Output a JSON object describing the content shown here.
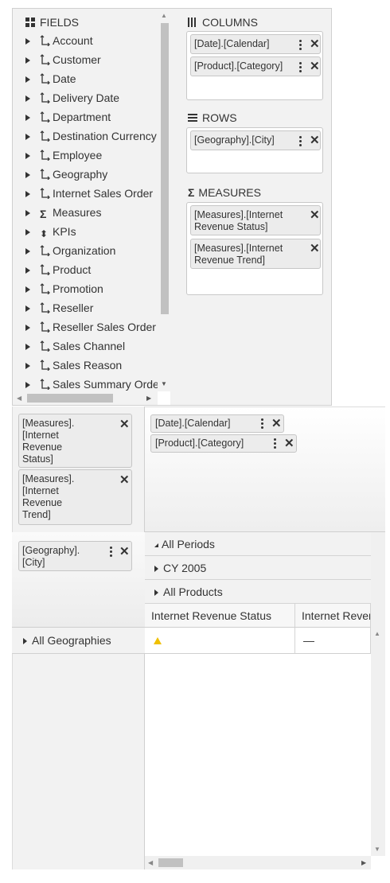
{
  "configurator": {
    "fields_title": "FIELDS",
    "fields": [
      {
        "label": "Account",
        "icon": "hierarchy-icon"
      },
      {
        "label": "Customer",
        "icon": "hierarchy-icon"
      },
      {
        "label": "Date",
        "icon": "hierarchy-icon"
      },
      {
        "label": "Delivery Date",
        "icon": "hierarchy-icon"
      },
      {
        "label": "Department",
        "icon": "hierarchy-icon"
      },
      {
        "label": "Destination Currency",
        "icon": "hierarchy-icon"
      },
      {
        "label": "Employee",
        "icon": "hierarchy-icon"
      },
      {
        "label": "Geography",
        "icon": "hierarchy-icon"
      },
      {
        "label": "Internet Sales Order",
        "icon": "hierarchy-icon"
      },
      {
        "label": "Measures",
        "icon": "sigma-icon"
      },
      {
        "label": "KPIs",
        "icon": "kpi-icon"
      },
      {
        "label": "Organization",
        "icon": "hierarchy-icon"
      },
      {
        "label": "Product",
        "icon": "hierarchy-icon"
      },
      {
        "label": "Promotion",
        "icon": "hierarchy-icon"
      },
      {
        "label": "Reseller",
        "icon": "hierarchy-icon"
      },
      {
        "label": "Reseller Sales Order",
        "icon": "hierarchy-icon"
      },
      {
        "label": "Sales Channel",
        "icon": "hierarchy-icon"
      },
      {
        "label": "Sales Reason",
        "icon": "hierarchy-icon"
      },
      {
        "label": "Sales Summary Order",
        "icon": "hierarchy-icon"
      }
    ],
    "columns_title": "COLUMNS",
    "columns": [
      "[Date].[Calendar]",
      "[Product].[Category]"
    ],
    "rows_title": "ROWS",
    "rows": [
      "[Geography].[City]"
    ],
    "measures_title": "MEASURES",
    "measures": [
      "[Measures].[Internet Revenue Status]",
      "[Measures].[Internet Revenue Trend]"
    ]
  },
  "pivot": {
    "measure_chips": [
      {
        "lines": [
          "[Measures].",
          "[Internet",
          "Revenue",
          "Status]"
        ]
      },
      {
        "lines": [
          "[Measures].",
          "[Internet",
          "Revenue",
          "Trend]"
        ]
      }
    ],
    "column_chips": [
      "[Date].[Calendar]",
      "[Product].[Category]"
    ],
    "row_chip": {
      "lines": [
        "[Geography].",
        "[City]"
      ]
    },
    "column_headers": [
      "All Periods",
      "CY 2005",
      "All Products"
    ],
    "measure_headers": [
      "Internet Revenue Status",
      "Internet Revenue Trend"
    ],
    "row_headers": [
      "All Geographies"
    ],
    "cells": [
      {
        "status_icon": "warning-triangle-icon",
        "status_color": "#f0c000",
        "trend_text": "—"
      }
    ]
  },
  "colors": {
    "panel_bg": "#f2f2f2",
    "chip_bg": "#ececec",
    "border": "#c6c6c6",
    "warning": "#f0c000"
  }
}
